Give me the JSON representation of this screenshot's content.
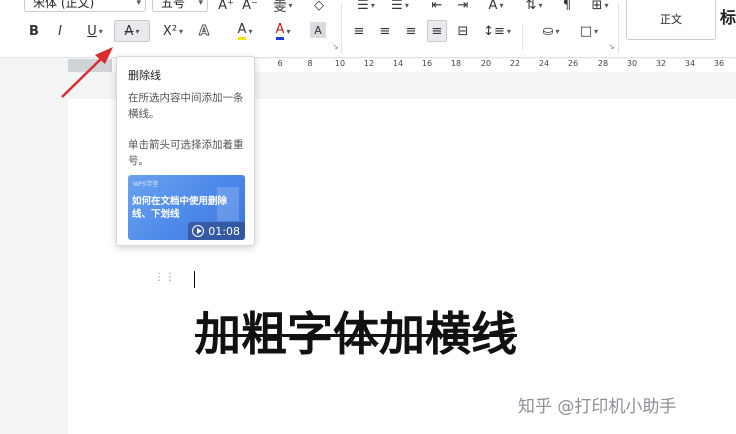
{
  "ribbon": {
    "font_name": "宋体 (正文)",
    "font_size": "五号",
    "bold": "B",
    "italic": "I",
    "underline": "U",
    "strikethrough": "A",
    "superscript": "X²",
    "text_effect": "A",
    "highlight": "A",
    "font_color": "A",
    "char_shading": "A",
    "grow_font": "A⁺",
    "clear_format": "◇",
    "style_normal": "正文",
    "style_next": "标"
  },
  "colors": {
    "highlight_bar": "#f3e600",
    "font_color_bar": "#1a3fcf",
    "accent_red": "#d92b2b"
  },
  "ruler": {
    "ticks": [
      "6",
      "8",
      "10",
      "12",
      "14",
      "16",
      "18",
      "20",
      "22",
      "24",
      "26",
      "28",
      "30",
      "32",
      "34",
      "36"
    ]
  },
  "tooltip": {
    "title": "删除线",
    "description": "在所选内容中间添加一条横线。",
    "hint": "单击箭头可选择添加着重号。",
    "video_brand": "WPS学堂",
    "video_title": "如何在文档中使用删除线、下划线",
    "video_duration": "01:08"
  },
  "document": {
    "body_text": "加粗字体加横线",
    "watermark": "知乎 @打印机小助手"
  }
}
